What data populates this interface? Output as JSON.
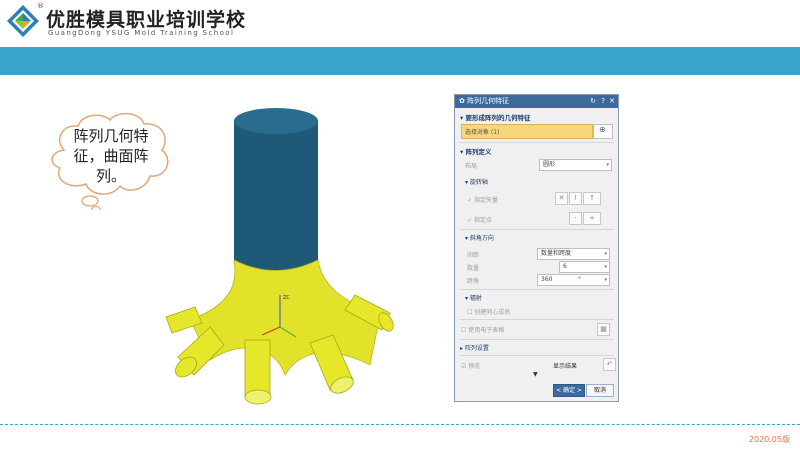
{
  "header": {
    "logo_reg": "®",
    "title_cn": "优胜模具职业培训学校",
    "title_en": "GuangDong YSUG Mold Training School"
  },
  "callout": {
    "text": "阵列几何特征，曲面阵列。"
  },
  "model_label": {
    "axis": "ZC"
  },
  "dialog": {
    "title": "阵列几何特征",
    "title_controls": [
      "↻",
      "?",
      "✕"
    ],
    "section_geometry": "要形成阵列的几何特征",
    "select_object": "选择对象 (1)",
    "section_pattern": "阵列定义",
    "layout_label": "布局",
    "layout_value": "圆形",
    "section_rotation_axis": "旋转轴",
    "specify_vector": "指定矢量",
    "specify_point": "指定点",
    "section_angular": "斜角方向",
    "spacing_label": "间距",
    "spacing_value": "数量和跨度",
    "count_label": "数量",
    "count_value": "6",
    "span_label": "跨角",
    "span_value": "360",
    "span_unit": "°",
    "section_radiate": "辐射",
    "create_concentric": "创建同心成员",
    "use_spreadsheet": "使用电子表格",
    "section_settings": "阵列设置",
    "preview": "预览",
    "show_result": "显示结果",
    "ok": "< 确定 >",
    "cancel": "取消"
  },
  "footer": {
    "version": "2020.05版"
  },
  "colors": {
    "banner": "#3aa3c9",
    "cylinder": "#1e5a78",
    "yellow_body": "#e6e62a",
    "dialog_title": "#3c6a9c",
    "footer_text": "#e07050"
  }
}
